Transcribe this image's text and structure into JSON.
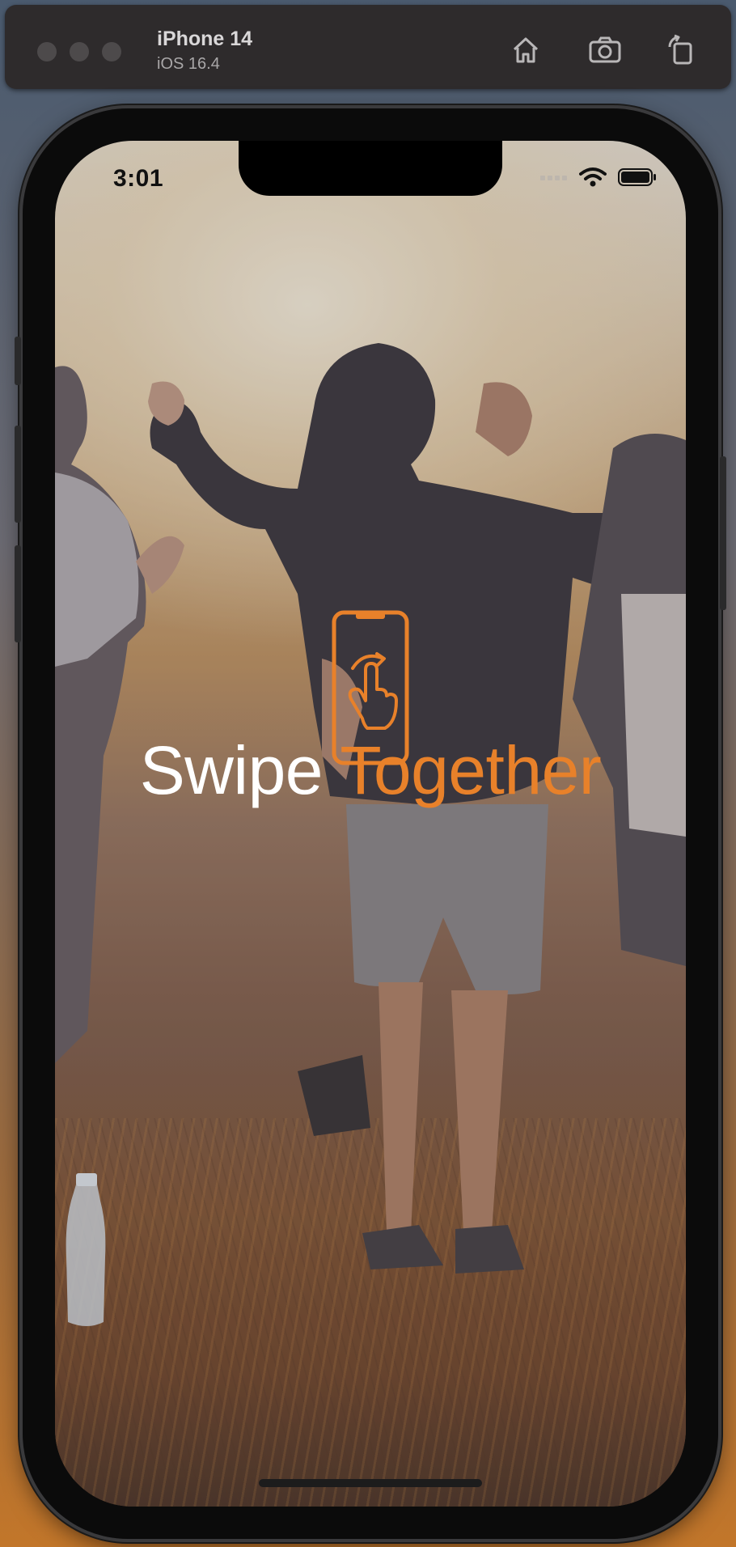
{
  "simulator": {
    "device_name": "iPhone 14",
    "os_version": "iOS 16.4",
    "toolbar_icons": [
      "home-icon",
      "screenshot-camera-icon",
      "rotate-icon"
    ]
  },
  "status_bar": {
    "time": "3:01",
    "icons": [
      "signal-icon",
      "wifi-icon",
      "battery-icon"
    ]
  },
  "app": {
    "logo_icon": "phone-swipe-gesture-icon",
    "title_part1": "Swipe",
    "title_part2": "Together"
  },
  "colors": {
    "accent": "#e8812a",
    "title_white": "#ffffff",
    "toolbar_bg": "#2e2b2c"
  }
}
